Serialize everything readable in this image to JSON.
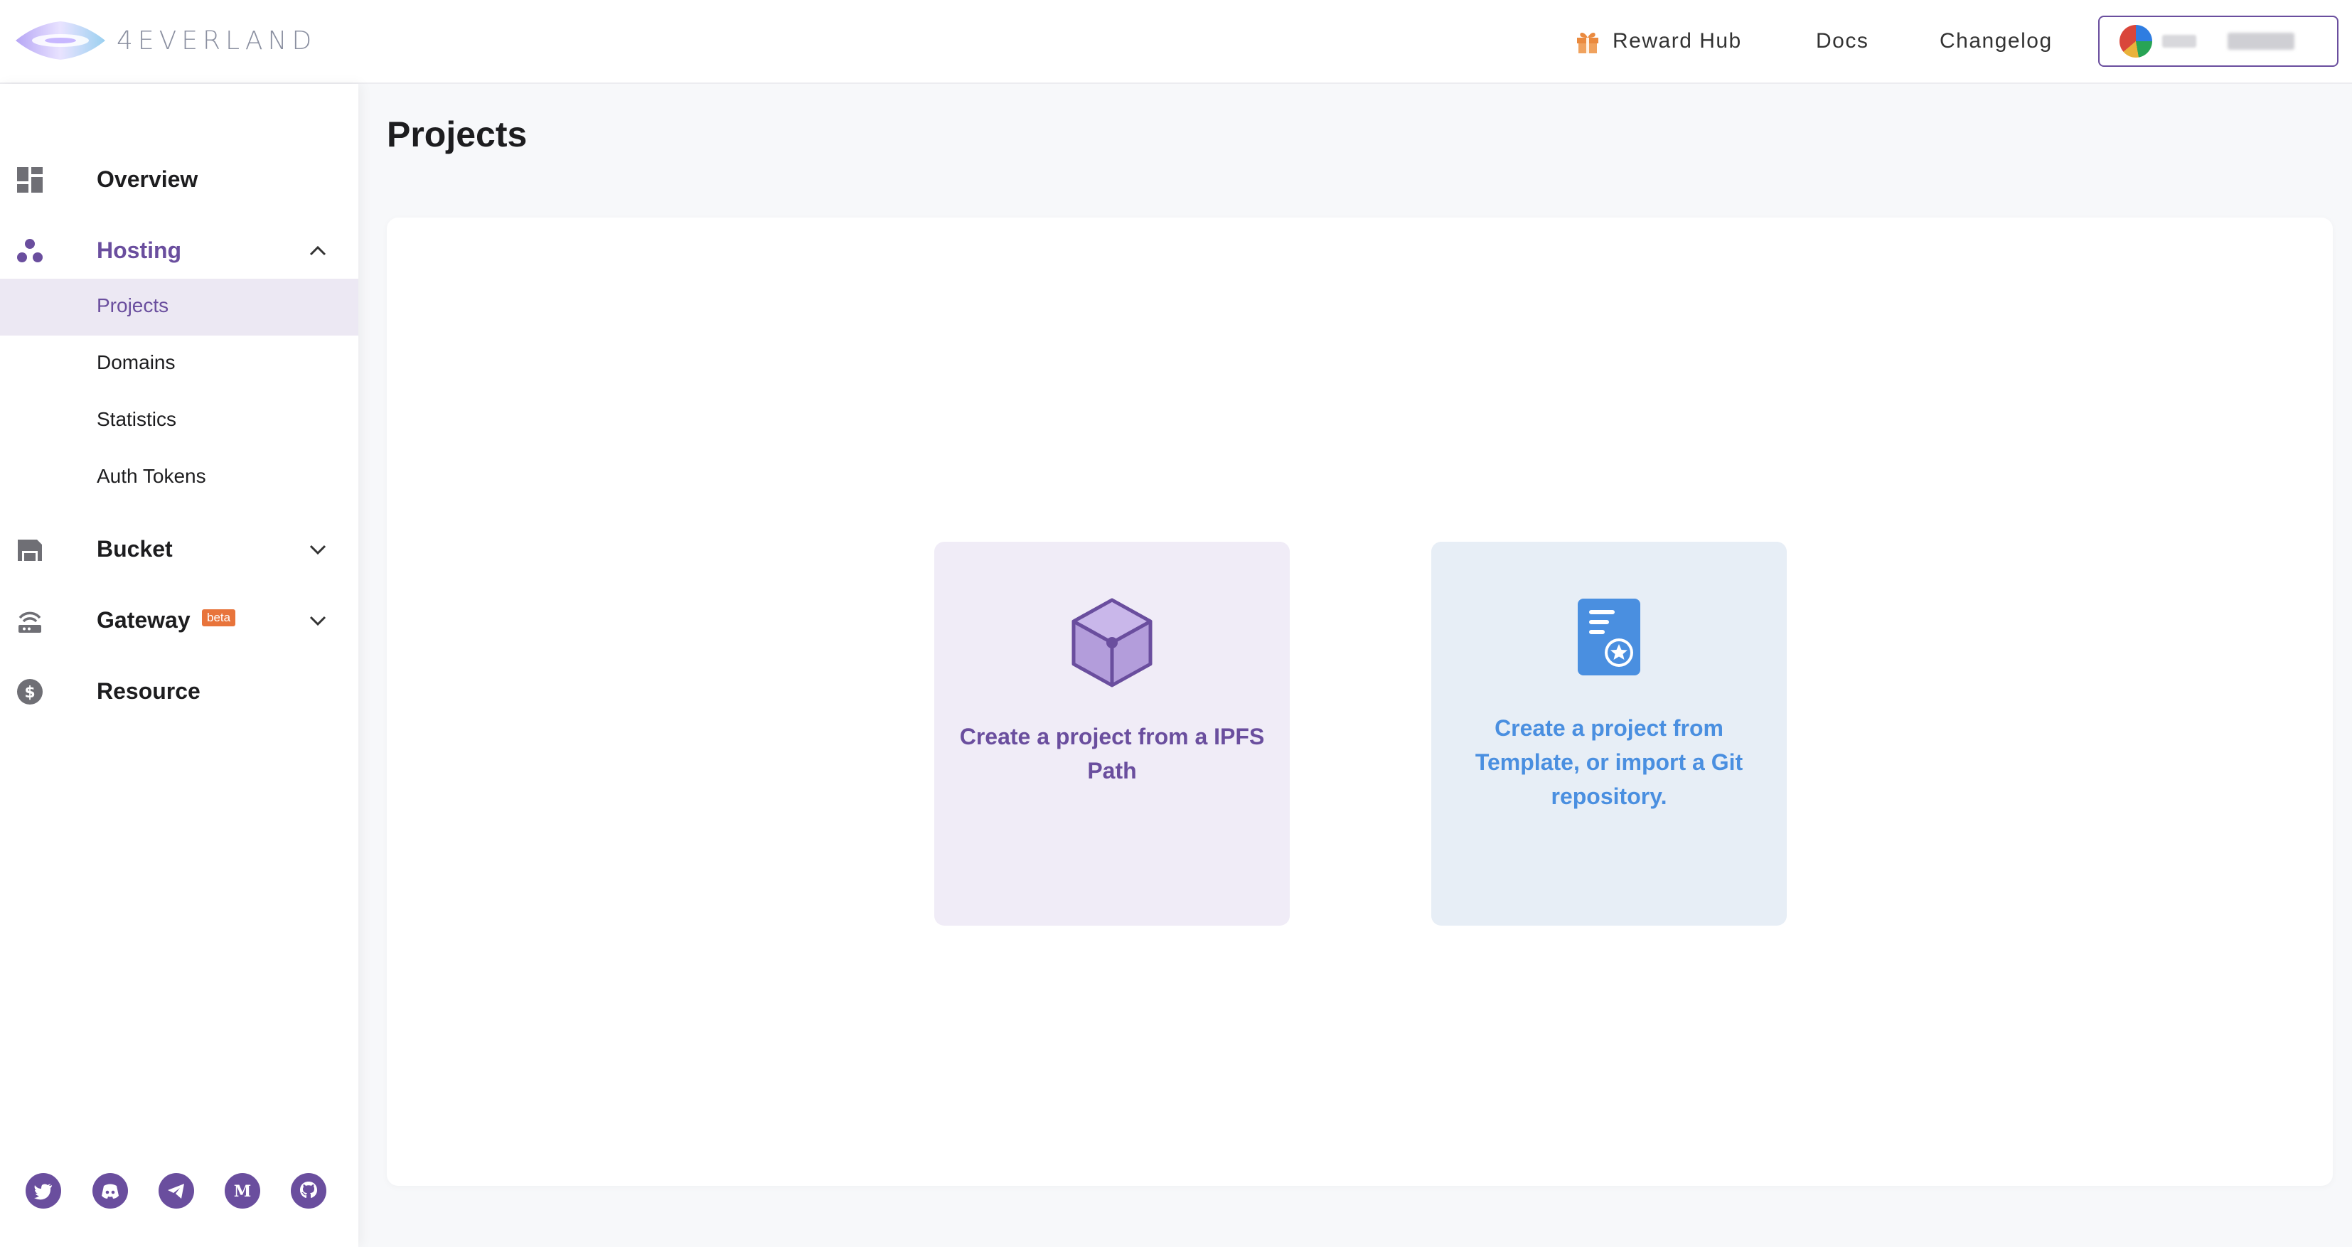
{
  "app": {
    "logo_text": "4EVERLAND"
  },
  "header": {
    "nav": [
      {
        "label": "Reward Hub",
        "icon": "gift-icon"
      },
      {
        "label": "Docs"
      },
      {
        "label": "Changelog"
      }
    ]
  },
  "sidebar": {
    "items": [
      {
        "label": "Overview",
        "icon": "dashboard-icon"
      },
      {
        "label": "Hosting",
        "icon": "hosting-icon",
        "expanded": true,
        "children": [
          {
            "label": "Projects",
            "active": true
          },
          {
            "label": "Domains"
          },
          {
            "label": "Statistics"
          },
          {
            "label": "Auth Tokens"
          }
        ]
      },
      {
        "label": "Bucket",
        "icon": "bucket-icon",
        "expanded": false
      },
      {
        "label": "Gateway",
        "icon": "gateway-icon",
        "badge": "beta",
        "expanded": false
      },
      {
        "label": "Resource",
        "icon": "dollar-icon"
      }
    ],
    "social": [
      "twitter-icon",
      "discord-icon",
      "telegram-icon",
      "medium-icon",
      "github-icon"
    ]
  },
  "main": {
    "title": "Projects",
    "cards": [
      {
        "text": "Create a project from a IPFS Path",
        "icon": "cube-icon"
      },
      {
        "text": "Create a project from Template, or import a Git repository.",
        "icon": "template-document-icon"
      }
    ]
  },
  "colors": {
    "accent": "#6a4e9e",
    "blue": "#4a8fe0",
    "badge": "#e8743b",
    "card_purple_bg": "#f0ecf7",
    "card_blue_bg": "#e7eef6"
  }
}
